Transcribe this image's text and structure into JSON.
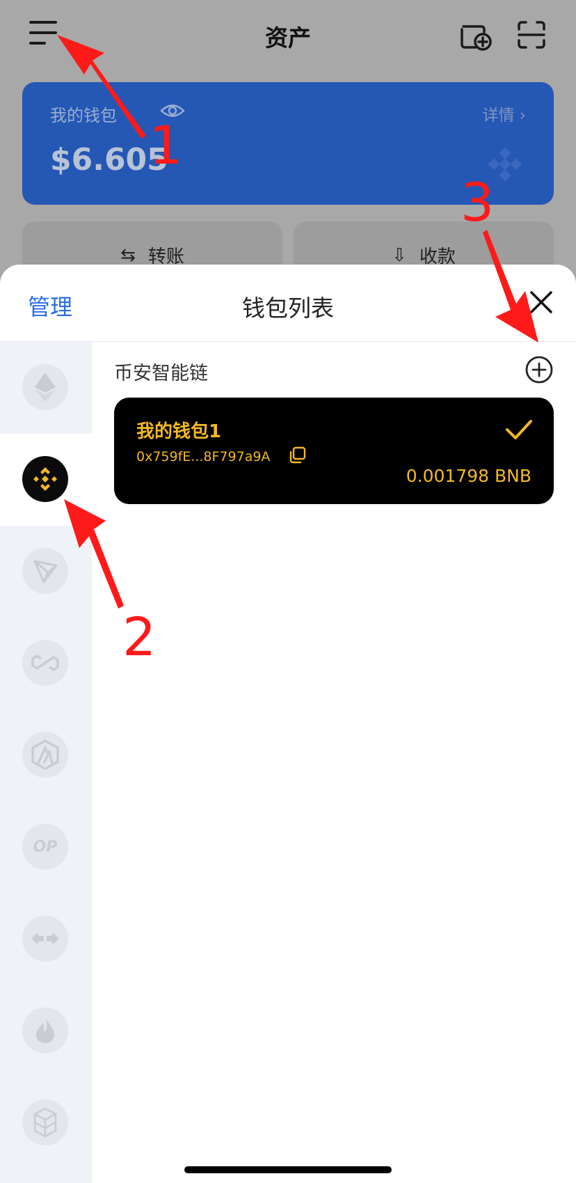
{
  "header": {
    "title": "资产"
  },
  "wallet_card": {
    "name": "我的钱包",
    "detail": "详情",
    "balance": "$6.605"
  },
  "actions": {
    "transfer": "转账",
    "receive": "收款"
  },
  "sheet": {
    "manage_label": "管理",
    "title": "钱包列表",
    "network_label": "币安智能链",
    "chains": [
      "ethereum",
      "bnb-chain",
      "tron",
      "polygon",
      "arbitrum",
      "optimism",
      "cross-chain",
      "fire",
      "fantom"
    ],
    "optimism_text": "OP",
    "active_chain": "bnb-chain",
    "wallets": [
      {
        "name": "我的钱包1",
        "address": "0x759fE...8F797a9A",
        "balance": "0.001798 BNB",
        "selected": true
      }
    ]
  },
  "annotations": [
    "1",
    "2",
    "3"
  ],
  "colors": {
    "accent": "#2a6de8",
    "wallet_card": "#2557b5",
    "bnb_yellow": "#f3b926",
    "annotation": "#ff1a1a"
  }
}
